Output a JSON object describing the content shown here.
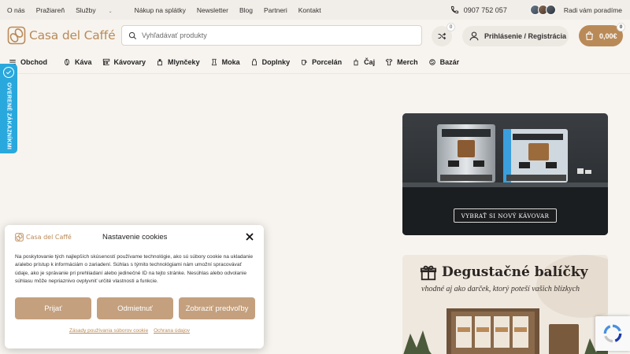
{
  "topbar": {
    "links": [
      "O nás",
      "Pražiareň",
      "Služby",
      "Nákup na splátky",
      "Newsletter",
      "Blog",
      "Partneri",
      "Kontakt"
    ],
    "phone": "0907 752 057",
    "help_text": "Radi vám poradíme"
  },
  "header": {
    "logo_text": "Casa del Caffé",
    "search_placeholder": "Vyhľadávať produkty",
    "compare_count": "0",
    "login_label": "Prihlásenie / Registrácia",
    "cart_total": "0,00€",
    "cart_count": "0"
  },
  "nav": {
    "items": [
      {
        "label": "Obchod",
        "icon": "menu-icon"
      },
      {
        "label": "Káva",
        "icon": "coffee-bean-icon"
      },
      {
        "label": "Kávovary",
        "icon": "espresso-machine-icon"
      },
      {
        "label": "Mlynčeky",
        "icon": "grinder-icon"
      },
      {
        "label": "Moka",
        "icon": "moka-pot-icon"
      },
      {
        "label": "Doplnky",
        "icon": "accessories-icon"
      },
      {
        "label": "Porcelán",
        "icon": "cup-icon"
      },
      {
        "label": "Čaj",
        "icon": "tea-icon"
      },
      {
        "label": "Merch",
        "icon": "tshirt-icon"
      },
      {
        "label": "Bazár",
        "icon": "recycle-icon"
      }
    ]
  },
  "sidetab": {
    "label": "OVERENÉ ZÁKAZNÍKMI"
  },
  "banners": {
    "machines_cta": "VYBRAŤ SI NOVÝ KÁVOVAR",
    "tasting_title": "Degustačné balíčky",
    "tasting_subtitle": "vhodné aj ako darček, ktorý poteší vašich blízkych"
  },
  "cookie": {
    "logo_text": "Casa del Caffé",
    "title": "Nastavenie cookies",
    "body": "Na poskytovanie tých najlepších skúseností používame technológie, ako sú súbory cookie na ukladanie a/alebo prístup k informáciám o zariadení. Súhlas s týmito technológiami nám umožní spracovávať údaje, ako je správanie pri prehliadaní alebo jedinečné ID na tejto stránke. Nesúhlas alebo odvolanie súhlasu môže nepriaznivo ovplyvniť určité vlastnosti a funkcie.",
    "accept": "Prijať",
    "deny": "Odmietnuť",
    "preferences": "Zobraziť predvoľby",
    "policy_link": "Zásady používania súborov cookie",
    "privacy_link": "Ochrana údajov"
  },
  "colors": {
    "brand": "#b98a58",
    "cookie_button": "#c4a07e",
    "sidetab": "#29a8dd"
  }
}
